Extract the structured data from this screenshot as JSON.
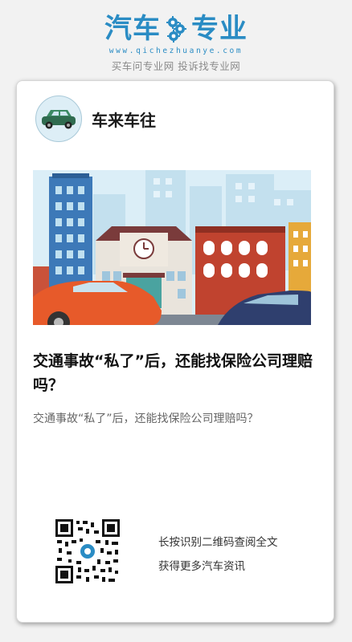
{
  "brand": {
    "word_left": "汽车",
    "word_right": "专业",
    "url": "www.qichezhuanye.com",
    "tagline": "买车问专业网  投诉找专业网",
    "color": "#2a8cc4"
  },
  "account": {
    "name": "车来车往",
    "avatar_icon": "green-car-icon"
  },
  "article": {
    "hero_icon": "city-traffic-illustration",
    "title": "交通事故“私了”后，还能找保险公司理赔吗？",
    "summary": "交通事故“私了”后，还能找保险公司理赔吗？"
  },
  "qr": {
    "icon": "qr-code-icon",
    "line1": "长按识别二维码查阅全文",
    "line2": "获得更多汽车资讯"
  }
}
